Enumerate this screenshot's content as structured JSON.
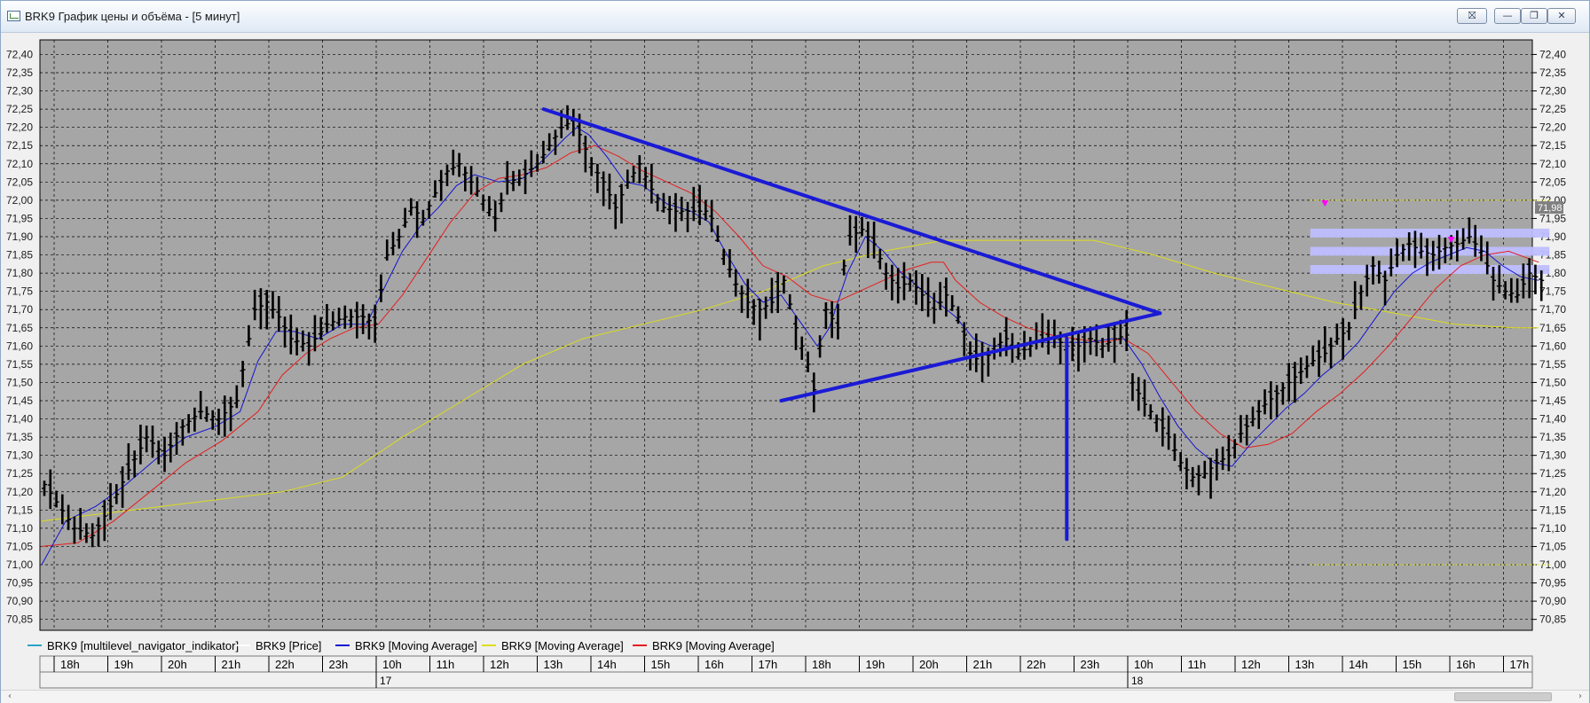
{
  "window": {
    "title": "BRK9 График цены и объёма - [5 минут]",
    "buttons": {
      "pin": "⛝",
      "minimize": "—",
      "maximize": "❐",
      "close": "✕"
    }
  },
  "scrollbar": {
    "left_arrow": "‹",
    "right_arrow": "›"
  },
  "chart_data": {
    "type": "line",
    "instrument": "BRK9",
    "timeframe": "5 минут",
    "ylim": [
      70.82,
      72.44
    ],
    "y_ticks": [
      "72,40",
      "72,35",
      "72,30",
      "72,25",
      "72,20",
      "72,15",
      "72,10",
      "72,05",
      "72,00",
      "71,95",
      "71,90",
      "71,85",
      "71,80",
      "71,75",
      "71,70",
      "71,65",
      "71,60",
      "71,55",
      "71,50",
      "71,45",
      "71,40",
      "71,35",
      "71,30",
      "71,25",
      "71,20",
      "71,15",
      "71,10",
      "71,05",
      "71,00",
      "70,95",
      "70,90",
      "70,85"
    ],
    "x_hours": [
      "18h",
      "19h",
      "20h",
      "21h",
      "22h",
      "23h",
      "10h",
      "11h",
      "12h",
      "13h",
      "14h",
      "15h",
      "16h",
      "17h",
      "18h",
      "19h",
      "20h",
      "21h",
      "22h",
      "23h",
      "10h",
      "11h",
      "12h",
      "13h",
      "14h",
      "15h",
      "16h",
      "17h"
    ],
    "days": [
      "17",
      "18"
    ],
    "current_price_label": "71,98",
    "grid": true,
    "colors": {
      "background": "#a6a6a6",
      "grid": "#000000",
      "price": "#000000",
      "ma_fast": "#1414d2",
      "ma_slow": "#e61e1e",
      "ma_long": "#dcdc1e",
      "pattern": "#1a1ad6",
      "level_band": "#bebeff",
      "marker": "#ff00ff"
    },
    "price_path": [
      [
        0,
        71.22
      ],
      [
        5,
        71.1
      ],
      [
        8,
        71.08
      ],
      [
        11,
        71.16
      ],
      [
        14,
        71.26
      ],
      [
        17,
        71.35
      ],
      [
        20,
        71.3
      ],
      [
        23,
        71.38
      ],
      [
        26,
        71.42
      ],
      [
        29,
        71.4
      ],
      [
        32,
        71.45
      ],
      [
        34,
        71.62
      ],
      [
        35,
        71.7
      ],
      [
        37,
        71.72
      ],
      [
        39,
        71.68
      ],
      [
        41,
        71.62
      ],
      [
        44,
        71.6
      ],
      [
        47,
        71.66
      ],
      [
        50,
        71.68
      ],
      [
        53,
        71.68
      ],
      [
        55,
        71.66
      ],
      [
        57,
        71.85
      ],
      [
        59,
        71.9
      ],
      [
        61,
        71.98
      ],
      [
        63,
        71.95
      ],
      [
        65,
        72.02
      ],
      [
        67,
        72.08
      ],
      [
        69,
        72.1
      ],
      [
        71,
        72.05
      ],
      [
        73,
        72.0
      ],
      [
        75,
        71.95
      ],
      [
        77,
        72.05
      ],
      [
        79,
        72.06
      ],
      [
        82,
        72.1
      ],
      [
        84,
        72.15
      ],
      [
        86,
        72.2
      ],
      [
        88,
        72.22
      ],
      [
        89,
        72.18
      ],
      [
        91,
        72.1
      ],
      [
        93,
        72.05
      ],
      [
        95,
        71.98
      ],
      [
        97,
        72.05
      ],
      [
        99,
        72.1
      ],
      [
        101,
        72.03
      ],
      [
        103,
        71.98
      ],
      [
        105,
        71.97
      ],
      [
        108,
        71.97
      ],
      [
        110,
        71.97
      ],
      [
        111,
        71.95
      ],
      [
        113,
        71.85
      ],
      [
        115,
        71.77
      ],
      [
        117,
        71.72
      ],
      [
        119,
        71.7
      ],
      [
        121,
        71.72
      ],
      [
        123,
        71.78
      ],
      [
        125,
        71.65
      ],
      [
        127,
        71.55
      ],
      [
        128,
        71.48
      ],
      [
        129,
        71.6
      ],
      [
        130,
        71.7
      ],
      [
        132,
        71.65
      ],
      [
        133,
        71.82
      ],
      [
        134,
        71.9
      ],
      [
        136,
        71.92
      ],
      [
        138,
        71.88
      ],
      [
        140,
        71.8
      ],
      [
        142,
        71.76
      ],
      [
        144,
        71.78
      ],
      [
        146,
        71.74
      ],
      [
        148,
        71.7
      ],
      [
        150,
        71.74
      ],
      [
        152,
        71.68
      ],
      [
        154,
        71.58
      ],
      [
        156,
        71.55
      ],
      [
        158,
        71.6
      ],
      [
        160,
        71.62
      ],
      [
        162,
        71.58
      ],
      [
        164,
        71.6
      ],
      [
        166,
        71.62
      ],
      [
        168,
        71.62
      ],
      [
        170,
        71.6
      ],
      [
        172,
        71.6
      ],
      [
        174,
        71.62
      ],
      [
        176,
        71.6
      ],
      [
        178,
        71.62
      ],
      [
        180,
        71.63
      ],
      [
        181,
        71.5
      ],
      [
        183,
        71.44
      ],
      [
        185,
        71.4
      ],
      [
        187,
        71.35
      ],
      [
        189,
        71.28
      ],
      [
        191,
        71.24
      ],
      [
        193,
        71.25
      ],
      [
        195,
        71.28
      ],
      [
        197,
        71.3
      ],
      [
        199,
        71.36
      ],
      [
        201,
        71.4
      ],
      [
        203,
        71.44
      ],
      [
        205,
        71.47
      ],
      [
        207,
        71.5
      ],
      [
        209,
        71.53
      ],
      [
        211,
        71.56
      ],
      [
        213,
        71.58
      ],
      [
        215,
        71.62
      ],
      [
        217,
        71.65
      ],
      [
        219,
        71.75
      ],
      [
        221,
        71.82
      ],
      [
        223,
        71.78
      ],
      [
        225,
        71.85
      ],
      [
        227,
        71.88
      ],
      [
        229,
        71.86
      ],
      [
        231,
        71.85
      ],
      [
        233,
        71.87
      ],
      [
        235,
        71.88
      ],
      [
        237,
        71.9
      ],
      [
        239,
        71.86
      ],
      [
        241,
        71.78
      ],
      [
        243,
        71.75
      ],
      [
        245,
        71.74
      ],
      [
        247,
        71.8
      ],
      [
        249,
        71.78
      ]
    ],
    "ma_fast_path": [
      [
        0,
        71.0
      ],
      [
        4,
        71.12
      ],
      [
        9,
        71.16
      ],
      [
        14,
        71.22
      ],
      [
        19,
        71.29
      ],
      [
        24,
        71.35
      ],
      [
        29,
        71.38
      ],
      [
        33,
        71.42
      ],
      [
        36,
        71.56
      ],
      [
        39,
        71.64
      ],
      [
        42,
        71.64
      ],
      [
        46,
        71.62
      ],
      [
        50,
        71.66
      ],
      [
        54,
        71.66
      ],
      [
        57,
        71.76
      ],
      [
        60,
        71.86
      ],
      [
        63,
        71.93
      ],
      [
        66,
        71.98
      ],
      [
        69,
        72.04
      ],
      [
        72,
        72.07
      ],
      [
        76,
        72.05
      ],
      [
        80,
        72.06
      ],
      [
        84,
        72.12
      ],
      [
        87,
        72.17
      ],
      [
        89,
        72.2
      ],
      [
        91,
        72.18
      ],
      [
        94,
        72.12
      ],
      [
        97,
        72.05
      ],
      [
        100,
        72.04
      ],
      [
        104,
        71.99
      ],
      [
        108,
        71.97
      ],
      [
        111,
        71.94
      ],
      [
        114,
        71.85
      ],
      [
        117,
        71.77
      ],
      [
        120,
        71.72
      ],
      [
        123,
        71.74
      ],
      [
        126,
        71.67
      ],
      [
        129,
        71.6
      ],
      [
        131,
        71.65
      ],
      [
        134,
        71.8
      ],
      [
        137,
        71.9
      ],
      [
        140,
        71.86
      ],
      [
        143,
        71.8
      ],
      [
        146,
        71.76
      ],
      [
        149,
        71.72
      ],
      [
        152,
        71.68
      ],
      [
        155,
        71.62
      ],
      [
        158,
        71.6
      ],
      [
        162,
        71.6
      ],
      [
        166,
        71.61
      ],
      [
        170,
        71.61
      ],
      [
        174,
        71.61
      ],
      [
        178,
        71.62
      ],
      [
        180,
        71.62
      ],
      [
        183,
        71.55
      ],
      [
        186,
        71.46
      ],
      [
        189,
        71.38
      ],
      [
        192,
        71.32
      ],
      [
        195,
        71.28
      ],
      [
        198,
        71.27
      ],
      [
        201,
        71.33
      ],
      [
        204,
        71.38
      ],
      [
        207,
        71.43
      ],
      [
        210,
        71.47
      ],
      [
        213,
        71.52
      ],
      [
        216,
        71.56
      ],
      [
        219,
        71.61
      ],
      [
        222,
        71.68
      ],
      [
        225,
        71.75
      ],
      [
        228,
        71.8
      ],
      [
        231,
        71.83
      ],
      [
        234,
        71.85
      ],
      [
        237,
        71.87
      ],
      [
        240,
        71.86
      ],
      [
        243,
        71.82
      ],
      [
        246,
        71.79
      ],
      [
        249,
        71.78
      ]
    ],
    "ma_slow_path": [
      [
        0,
        71.05
      ],
      [
        6,
        71.06
      ],
      [
        12,
        71.12
      ],
      [
        18,
        71.2
      ],
      [
        24,
        71.28
      ],
      [
        30,
        71.34
      ],
      [
        36,
        71.42
      ],
      [
        40,
        71.52
      ],
      [
        44,
        71.58
      ],
      [
        48,
        71.62
      ],
      [
        52,
        71.65
      ],
      [
        56,
        71.66
      ],
      [
        60,
        71.74
      ],
      [
        64,
        71.84
      ],
      [
        68,
        71.94
      ],
      [
        72,
        72.02
      ],
      [
        76,
        72.06
      ],
      [
        80,
        72.07
      ],
      [
        84,
        72.09
      ],
      [
        88,
        72.13
      ],
      [
        92,
        72.15
      ],
      [
        96,
        72.12
      ],
      [
        100,
        72.08
      ],
      [
        104,
        72.05
      ],
      [
        108,
        72.02
      ],
      [
        112,
        71.97
      ],
      [
        116,
        71.9
      ],
      [
        120,
        71.82
      ],
      [
        124,
        71.79
      ],
      [
        128,
        71.74
      ],
      [
        132,
        71.72
      ],
      [
        136,
        71.75
      ],
      [
        140,
        71.78
      ],
      [
        144,
        71.81
      ],
      [
        148,
        71.83
      ],
      [
        150,
        71.83
      ],
      [
        152,
        71.78
      ],
      [
        156,
        71.72
      ],
      [
        160,
        71.68
      ],
      [
        164,
        71.65
      ],
      [
        168,
        71.63
      ],
      [
        172,
        71.62
      ],
      [
        176,
        71.61
      ],
      [
        180,
        71.62
      ],
      [
        184,
        71.58
      ],
      [
        188,
        71.5
      ],
      [
        192,
        71.42
      ],
      [
        196,
        71.36
      ],
      [
        200,
        71.32
      ],
      [
        204,
        71.33
      ],
      [
        208,
        71.36
      ],
      [
        212,
        71.42
      ],
      [
        216,
        71.47
      ],
      [
        220,
        71.53
      ],
      [
        224,
        71.6
      ],
      [
        228,
        71.68
      ],
      [
        232,
        71.76
      ],
      [
        236,
        71.82
      ],
      [
        240,
        71.85
      ],
      [
        244,
        71.86
      ],
      [
        249,
        71.83
      ]
    ],
    "ma_long_path": [
      [
        0,
        71.12
      ],
      [
        20,
        71.16
      ],
      [
        40,
        71.2
      ],
      [
        50,
        71.24
      ],
      [
        60,
        71.35
      ],
      [
        70,
        71.45
      ],
      [
        80,
        71.55
      ],
      [
        90,
        71.62
      ],
      [
        100,
        71.66
      ],
      [
        110,
        71.7
      ],
      [
        120,
        71.75
      ],
      [
        130,
        71.82
      ],
      [
        140,
        71.86
      ],
      [
        150,
        71.89
      ],
      [
        160,
        71.89
      ],
      [
        170,
        71.89
      ],
      [
        175,
        71.89
      ],
      [
        185,
        71.85
      ],
      [
        195,
        71.8
      ],
      [
        205,
        71.76
      ],
      [
        215,
        71.72
      ],
      [
        225,
        71.69
      ],
      [
        235,
        71.66
      ],
      [
        245,
        71.65
      ],
      [
        249,
        71.65
      ]
    ],
    "pattern_lines": [
      [
        [
          83.5,
          72.25
        ],
        [
          186,
          71.69
        ]
      ],
      [
        [
          123,
          71.45
        ],
        [
          186,
          71.69
        ]
      ],
      [
        [
          170.5,
          71.62
        ],
        [
          170.5,
          71.07
        ]
      ]
    ],
    "level_bands": [
      {
        "y": 71.91,
        "x0": 211,
        "x1": 249
      },
      {
        "y": 71.86,
        "x0": 211,
        "x1": 249
      },
      {
        "y": 71.81,
        "x0": 211,
        "x1": 249
      }
    ],
    "dotted_levels": [
      {
        "y": 72.0,
        "x0": 211,
        "x1": 249
      },
      {
        "y": 71.0,
        "x0": 211,
        "x1": 249
      }
    ],
    "markers": [
      {
        "x": 213,
        "y": 71.99
      },
      {
        "x": 234,
        "y": 71.89
      }
    ]
  },
  "legend": [
    {
      "label": "BRK9 [multilevel_navigator_indikator]",
      "color": "#2aa3c8"
    },
    {
      "label": "BRK9 [Price]",
      "color": "#ffffff"
    },
    {
      "label": "BRK9 [Moving Average]",
      "color": "#1414d2"
    },
    {
      "label": "BRK9 [Moving Average]",
      "color": "#dcdc1e"
    },
    {
      "label": "BRK9 [Moving Average]",
      "color": "#e61e1e"
    }
  ]
}
